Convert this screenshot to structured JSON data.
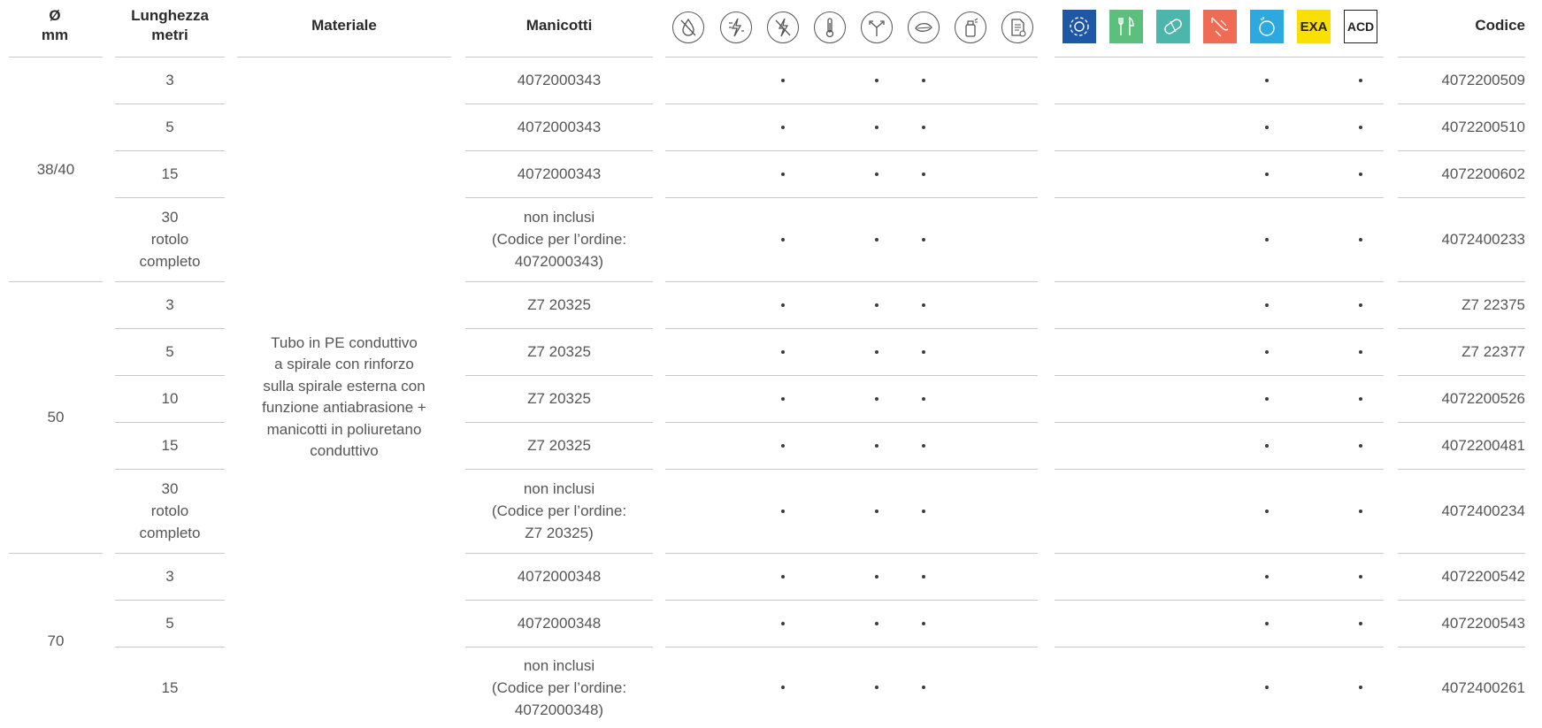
{
  "header": {
    "diameter": "Ø\nmm",
    "length": "Lunghezza\nmetri",
    "material": "Materiale",
    "sleeves": "Manicotti",
    "code": "Codice",
    "exa_label": "EXA",
    "acd_label": "ACD"
  },
  "property_icons": [
    "no-water-icon",
    "antistatic-icon",
    "no-static-icon",
    "thermometer-icon",
    "flexibility-arrows-icon",
    "eco-leaf-icon",
    "spray-bottle-icon",
    "certified-document-icon"
  ],
  "sector_icons": [
    {
      "name": "gear-sector-icon",
      "color": "#1e57a6"
    },
    {
      "name": "food-sector-icon",
      "color": "#5cbf7e"
    },
    {
      "name": "pharma-sector-icon",
      "color": "#4cb6ad"
    },
    {
      "name": "chemical-sector-icon",
      "color": "#ef6b53"
    },
    {
      "name": "cleaning-sector-icon",
      "color": "#2ea9df"
    },
    {
      "name": "exa-sector-icon",
      "color": "#f9e000"
    },
    {
      "name": "acd-sector-icon",
      "color": "#ffffff"
    }
  ],
  "material_text": "Tubo in PE conduttivo\na spirale con rinforzo\nsulla spirale esterna con\nfunzione antiabrasione +\nmanicotti in poliuretano\nconduttivo",
  "groups": [
    {
      "diameter": "38/40"
    },
    {
      "diameter": "50"
    },
    {
      "diameter": "70"
    }
  ],
  "rows": [
    {
      "length": "3",
      "sleeve": "4072000343",
      "code": "4072200509"
    },
    {
      "length": "5",
      "sleeve": "4072000343",
      "code": "4072200510"
    },
    {
      "length": "15",
      "sleeve": "4072000343",
      "code": "4072200602"
    },
    {
      "length": "30\nrotolo\ncompleto",
      "sleeve": "non inclusi\n(Codice per l’ordine:\n4072000343)",
      "code": "4072400233"
    },
    {
      "length": "3",
      "sleeve": "Z7 20325",
      "code": "Z7 22375"
    },
    {
      "length": "5",
      "sleeve": "Z7 20325",
      "code": "Z7 22377"
    },
    {
      "length": "10",
      "sleeve": "Z7 20325",
      "code": "4072200526"
    },
    {
      "length": "15",
      "sleeve": "Z7 20325",
      "code": "4072200481"
    },
    {
      "length": "30\nrotolo\ncompleto",
      "sleeve": "non inclusi\n(Codice per l’ordine:\nZ7 20325)",
      "code": "4072400234"
    },
    {
      "length": "3",
      "sleeve": "4072000348",
      "code": "4072200542"
    },
    {
      "length": "5",
      "sleeve": "4072000348",
      "code": "4072200543"
    },
    {
      "length": "15",
      "sleeve": "non inclusi\n(Codice per l’ordine:\n4072000348)",
      "code": "4072400261"
    }
  ],
  "markers": {
    "properties": [
      "no-static-icon",
      "flexibility-arrows-icon",
      "eco-leaf-icon"
    ],
    "sectors": [
      "cleaning-sector-icon",
      "acd-sector-icon"
    ]
  }
}
